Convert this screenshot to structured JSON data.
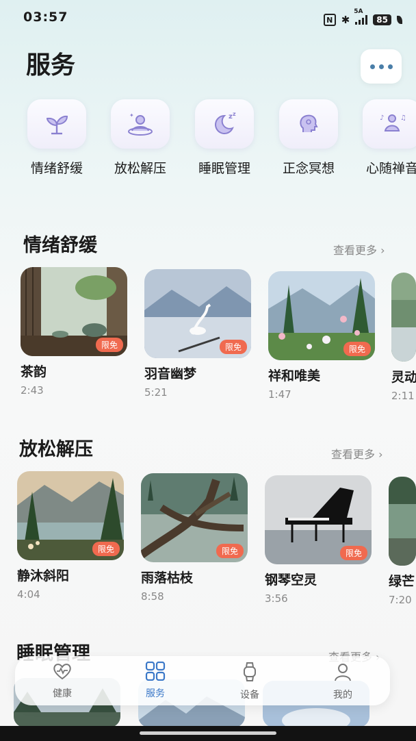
{
  "status": {
    "time": "03:57",
    "nfc": "N",
    "network": "5A",
    "battery": "85"
  },
  "header": {
    "title": "服务"
  },
  "categories": [
    {
      "label": "情绪舒缓",
      "icon": "sprout-icon"
    },
    {
      "label": "放松解压",
      "icon": "person-relax-icon"
    },
    {
      "label": "睡眠管理",
      "icon": "moon-sleep-icon"
    },
    {
      "label": "正念冥想",
      "icon": "head-mind-icon"
    },
    {
      "label": "心随禅音",
      "icon": "meditation-music-icon"
    }
  ],
  "sections": [
    {
      "title": "情绪舒缓",
      "more": "查看更多 ›",
      "cards": [
        {
          "title": "茶韵",
          "duration": "2:43",
          "badge": "限免"
        },
        {
          "title": "羽音幽梦",
          "duration": "5:21",
          "badge": "限免"
        },
        {
          "title": "祥和唯美",
          "duration": "1:47",
          "badge": "限免"
        },
        {
          "title": "灵动",
          "duration": "2:11",
          "badge": ""
        }
      ]
    },
    {
      "title": "放松解压",
      "more": "查看更多 ›",
      "cards": [
        {
          "title": "静沐斜阳",
          "duration": "4:04",
          "badge": "限免"
        },
        {
          "title": "雨落枯枝",
          "duration": "8:58",
          "badge": "限免"
        },
        {
          "title": "钢琴空灵",
          "duration": "3:56",
          "badge": "限免"
        },
        {
          "title": "绿芒",
          "duration": "7:20",
          "badge": ""
        }
      ]
    },
    {
      "title": "睡眠管理",
      "more": "查看更多 ›"
    }
  ],
  "nav": [
    {
      "label": "健康",
      "icon": "heart-icon"
    },
    {
      "label": "服务",
      "icon": "grid-icon"
    },
    {
      "label": "设备",
      "icon": "watch-icon"
    },
    {
      "label": "我的",
      "icon": "person-icon"
    }
  ],
  "colors": {
    "accent": "#3b78c8",
    "badge": "#f06a4f",
    "icon_purple": "#8a80d0"
  }
}
